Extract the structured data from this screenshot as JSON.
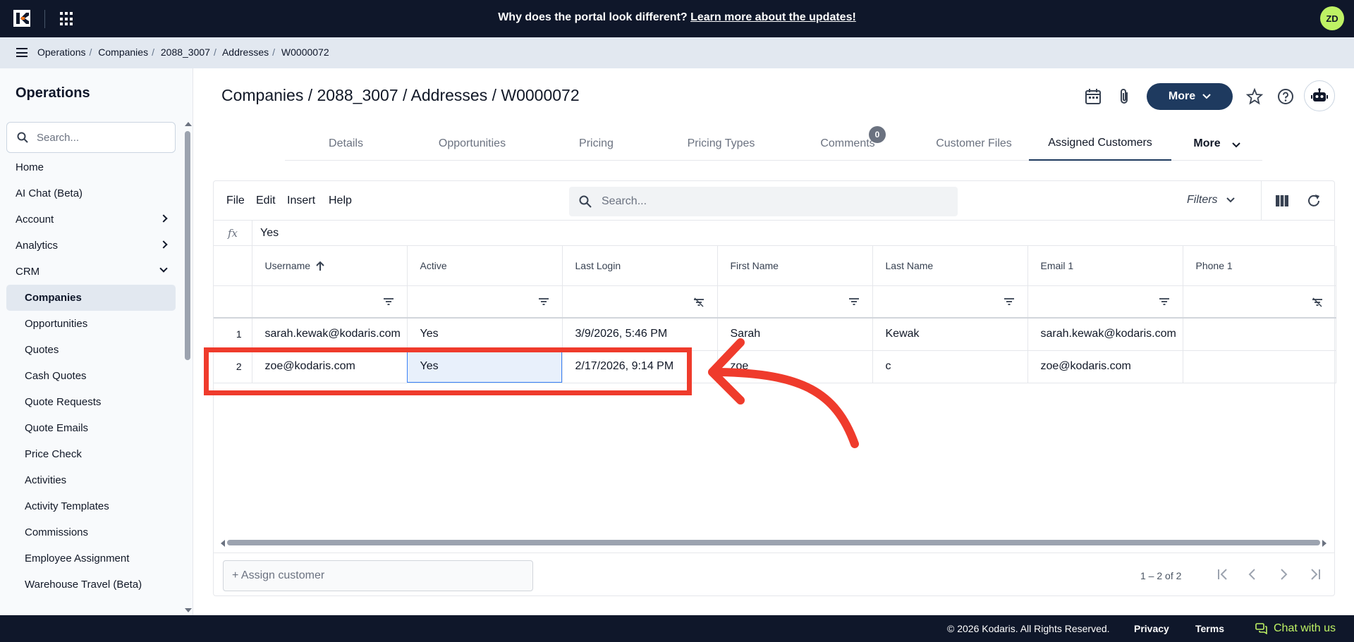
{
  "topbar": {
    "banner_text": "Why does the portal look different?",
    "banner_link": "Learn more about the updates!",
    "avatar_initials": "ZD",
    "brand_color": "#0f172a",
    "accent_color": "#bef264"
  },
  "breadcrumb": {
    "items": [
      "Operations",
      "Companies",
      "2088_3007",
      "Addresses",
      "W0000072"
    ]
  },
  "sidebar": {
    "title": "Operations",
    "search_placeholder": "Search...",
    "items": [
      {
        "label": "Home",
        "icon": ""
      },
      {
        "label": "AI Chat (Beta)",
        "icon": ""
      },
      {
        "label": "Account",
        "icon": "chevron-right-icon"
      },
      {
        "label": "Analytics",
        "icon": "chevron-right-icon"
      },
      {
        "label": "CRM",
        "icon": "chevron-down-icon"
      }
    ],
    "sub_items": [
      {
        "label": "Companies",
        "active": true
      },
      {
        "label": "Opportunities"
      },
      {
        "label": "Quotes"
      },
      {
        "label": "Cash Quotes"
      },
      {
        "label": "Quote Requests"
      },
      {
        "label": "Quote Emails"
      },
      {
        "label": "Price Check"
      },
      {
        "label": "Activities"
      },
      {
        "label": "Activity Templates"
      },
      {
        "label": "Commissions"
      },
      {
        "label": "Employee Assignment"
      },
      {
        "label": "Warehouse Travel (Beta)"
      }
    ]
  },
  "header": {
    "title": "Companies / 2088_3007 / Addresses / W0000072",
    "more_button": "More"
  },
  "tabs": {
    "items": [
      "Details",
      "Opportunities",
      "Pricing",
      "Pricing Types",
      "Comments",
      "Customer Files",
      "Assigned Customers"
    ],
    "comments_badge": "0",
    "active": "Assigned Customers",
    "more_label": "More"
  },
  "grid": {
    "menu": [
      "File",
      "Edit",
      "Insert",
      "Help"
    ],
    "search_placeholder": "Search...",
    "filters_label": "Filters",
    "formula_label": "fx",
    "formula_value": "Yes",
    "columns": [
      "Username",
      "Active",
      "Last Login",
      "First Name",
      "Last Name",
      "Email 1",
      "Phone 1"
    ],
    "rows": [
      {
        "num": "1",
        "cells": [
          "sarah.kewak@kodaris.com",
          "Yes",
          "3/9/2026, 5:46 PM",
          "Sarah",
          "Kewak",
          "sarah.kewak@kodaris.com",
          ""
        ]
      },
      {
        "num": "2",
        "cells": [
          "zoe@kodaris.com",
          "Yes",
          "2/17/2026, 9:14 PM",
          "zoe",
          "c",
          "zoe@kodaris.com",
          ""
        ]
      }
    ],
    "assign_placeholder": "+ Assign customer",
    "page_info": "1 – 2 of 2"
  },
  "annotation": {
    "color": "#ef3b2c"
  },
  "footer": {
    "copyright": "© 2026 Kodaris. All Rights Reserved.",
    "privacy": "Privacy",
    "terms": "Terms",
    "chat": "Chat with us"
  }
}
